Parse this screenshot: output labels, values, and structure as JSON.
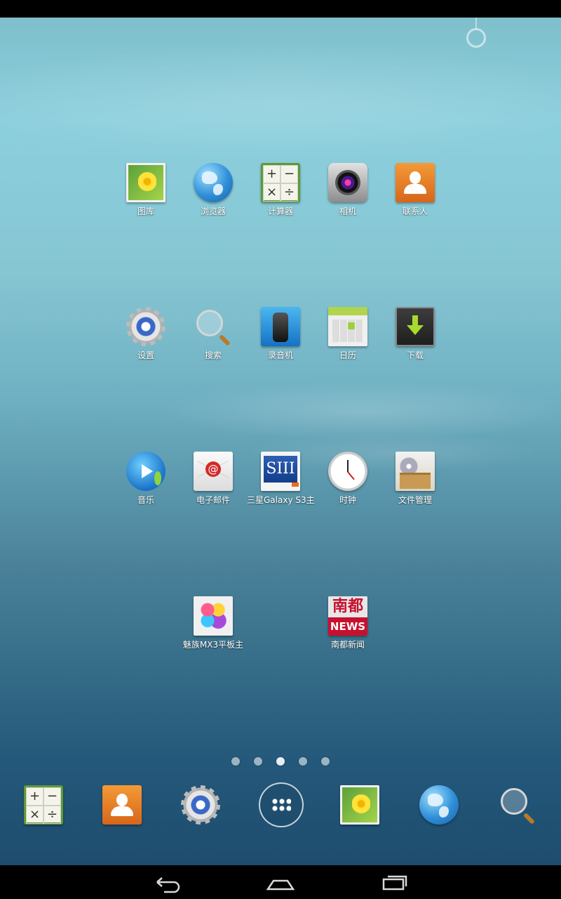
{
  "home": {
    "apps": [
      {
        "label": "图库",
        "icon": "gallery-icon"
      },
      {
        "label": "浏览器",
        "icon": "browser-globe-icon"
      },
      {
        "label": "计算器",
        "icon": "calculator-icon"
      },
      {
        "label": "相机",
        "icon": "camera-icon"
      },
      {
        "label": "联系人",
        "icon": "contacts-icon"
      },
      {
        "label": "设置",
        "icon": "settings-gear-icon"
      },
      {
        "label": "搜索",
        "icon": "search-magnifier-icon"
      },
      {
        "label": "录音机",
        "icon": "voice-recorder-icon"
      },
      {
        "label": "日历",
        "icon": "calendar-icon"
      },
      {
        "label": "下载",
        "icon": "download-icon"
      },
      {
        "label": "音乐",
        "icon": "music-icon"
      },
      {
        "label": "电子邮件",
        "icon": "email-icon"
      },
      {
        "label": "三星Galaxy S3主",
        "icon": "galaxy-s3-icon"
      },
      {
        "label": "时钟",
        "icon": "clock-icon"
      },
      {
        "label": "文件管理",
        "icon": "file-manager-icon"
      },
      {
        "label": "魅族MX3平板主",
        "icon": "meizu-mx3-icon"
      },
      {
        "label": "南都新闻",
        "icon": "nandu-news-icon"
      }
    ],
    "calc_keys": [
      "+",
      "−",
      "×",
      "÷"
    ],
    "news_icon": {
      "top": "南都",
      "bottom": "NEWS"
    },
    "page_indicator": {
      "count": 5,
      "active": 3
    }
  },
  "dock": {
    "items": [
      "calculator-icon",
      "contacts-icon",
      "settings-gear-icon",
      "all-apps-icon",
      "gallery-icon",
      "browser-globe-icon",
      "search-magnifier-icon"
    ]
  },
  "navbar": {
    "buttons": [
      "back-icon",
      "home-icon",
      "recent-apps-icon"
    ]
  },
  "colors": {
    "wallpaper_top": "#8ccfdd",
    "wallpaper_bottom": "#1d4c6e",
    "label_text": "#ffffff"
  }
}
